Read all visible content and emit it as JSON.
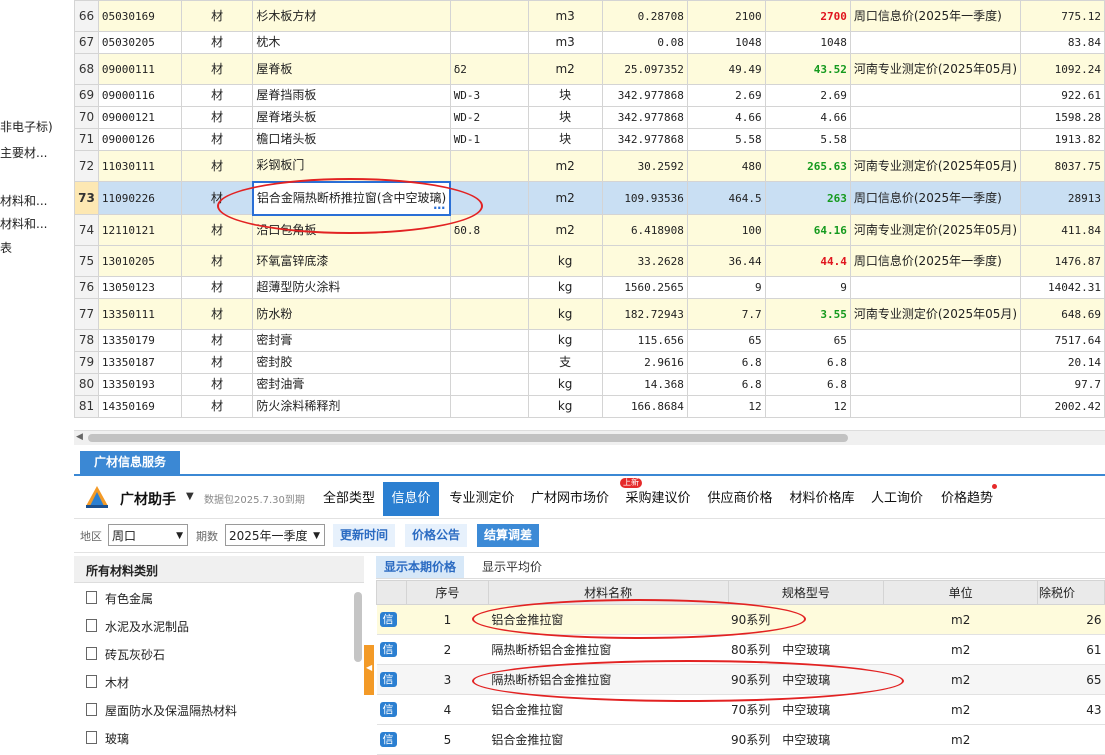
{
  "left_tree": [
    "非电子标)",
    "主要材...",
    "材料和...",
    "材料和...",
    "表"
  ],
  "materials": [
    {
      "n": "66",
      "code": "05030169",
      "type": "材",
      "name": "杉木板方材",
      "spec": "",
      "unit": "m3",
      "qty": "0.28708",
      "price": "2100",
      "market": "2700",
      "mcolor": "red",
      "source": "周口信息价(2025年一季度)",
      "total": "775.12",
      "style": "yellow"
    },
    {
      "n": "67",
      "code": "05030205",
      "type": "材",
      "name": "枕木",
      "spec": "",
      "unit": "m3",
      "qty": "0.08",
      "price": "1048",
      "market": "1048",
      "mcolor": "",
      "source": "",
      "total": "83.84",
      "style": "white"
    },
    {
      "n": "68",
      "code": "09000111",
      "type": "材",
      "name": "屋脊板",
      "spec": "δ2",
      "unit": "m2",
      "qty": "25.097352",
      "price": "49.49",
      "market": "43.52",
      "mcolor": "green",
      "source": "河南专业测定价(2025年05月)",
      "total": "1092.24",
      "style": "yellow"
    },
    {
      "n": "69",
      "code": "09000116",
      "type": "材",
      "name": "屋脊挡雨板",
      "spec": "WD-3",
      "unit": "块",
      "qty": "342.977868",
      "price": "2.69",
      "market": "2.69",
      "mcolor": "",
      "source": "",
      "total": "922.61",
      "style": "white"
    },
    {
      "n": "70",
      "code": "09000121",
      "type": "材",
      "name": "屋脊堵头板",
      "spec": "WD-2",
      "unit": "块",
      "qty": "342.977868",
      "price": "4.66",
      "market": "4.66",
      "mcolor": "",
      "source": "",
      "total": "1598.28",
      "style": "white"
    },
    {
      "n": "71",
      "code": "09000126",
      "type": "材",
      "name": "檐口堵头板",
      "spec": "WD-1",
      "unit": "块",
      "qty": "342.977868",
      "price": "5.58",
      "market": "5.58",
      "mcolor": "",
      "source": "",
      "total": "1913.82",
      "style": "white"
    },
    {
      "n": "72",
      "code": "11030111",
      "type": "材",
      "name": "彩钢板门",
      "spec": "",
      "unit": "m2",
      "qty": "30.2592",
      "price": "480",
      "market": "265.63",
      "mcolor": "green",
      "source": "河南专业测定价(2025年05月)",
      "total": "8037.75",
      "style": "yellow"
    },
    {
      "n": "73",
      "code": "11090226",
      "type": "材",
      "name": "铝合金隔热断桥推拉窗(含中空玻璃)",
      "spec": "",
      "unit": "m2",
      "qty": "109.93536",
      "price": "464.5",
      "market": "263",
      "mcolor": "green",
      "source": "周口信息价(2025年一季度)",
      "total": "28913",
      "style": "selected"
    },
    {
      "n": "74",
      "code": "12110121",
      "type": "材",
      "name": "沿口包角板",
      "spec": "δ0.8",
      "unit": "m2",
      "qty": "6.418908",
      "price": "100",
      "market": "64.16",
      "mcolor": "green",
      "source": "河南专业测定价(2025年05月)",
      "total": "411.84",
      "style": "yellow"
    },
    {
      "n": "75",
      "code": "13010205",
      "type": "材",
      "name": "环氧富锌底漆",
      "spec": "",
      "unit": "kg",
      "qty": "33.2628",
      "price": "36.44",
      "market": "44.4",
      "mcolor": "red",
      "source": "周口信息价(2025年一季度)",
      "total": "1476.87",
      "style": "yellow"
    },
    {
      "n": "76",
      "code": "13050123",
      "type": "材",
      "name": "超薄型防火涂料",
      "spec": "",
      "unit": "kg",
      "qty": "1560.2565",
      "price": "9",
      "market": "9",
      "mcolor": "",
      "source": "",
      "total": "14042.31",
      "style": "white"
    },
    {
      "n": "77",
      "code": "13350111",
      "type": "材",
      "name": "防水粉",
      "spec": "",
      "unit": "kg",
      "qty": "182.72943",
      "price": "7.7",
      "market": "3.55",
      "mcolor": "green",
      "source": "河南专业测定价(2025年05月)",
      "total": "648.69",
      "style": "yellow"
    },
    {
      "n": "78",
      "code": "13350179",
      "type": "材",
      "name": "密封膏",
      "spec": "",
      "unit": "kg",
      "qty": "115.656",
      "price": "65",
      "market": "65",
      "mcolor": "",
      "source": "",
      "total": "7517.64",
      "style": "white"
    },
    {
      "n": "79",
      "code": "13350187",
      "type": "材",
      "name": "密封胶",
      "spec": "",
      "unit": "支",
      "qty": "2.9616",
      "price": "6.8",
      "market": "6.8",
      "mcolor": "",
      "source": "",
      "total": "20.14",
      "style": "white"
    },
    {
      "n": "80",
      "code": "13350193",
      "type": "材",
      "name": "密封油膏",
      "spec": "",
      "unit": "kg",
      "qty": "14.368",
      "price": "6.8",
      "market": "6.8",
      "mcolor": "",
      "source": "",
      "total": "97.7",
      "style": "white"
    },
    {
      "n": "81",
      "code": "14350169",
      "type": "材",
      "name": "防火涂料稀释剂",
      "spec": "",
      "unit": "kg",
      "qty": "166.8684",
      "price": "12",
      "market": "12",
      "mcolor": "",
      "source": "",
      "total": "2002.42",
      "style": "white"
    }
  ],
  "panel": {
    "tab": "广材信息服务",
    "brand": "广材助手",
    "pkg": "数据包2025.7.30到期",
    "nav": [
      "全部类型",
      "信息价",
      "专业测定价",
      "广材网市场价",
      "采购建议价",
      "供应商价格",
      "材料价格库",
      "人工询价",
      "价格趋势"
    ],
    "new_badge": "上新",
    "filter": {
      "region_label": "地区",
      "region": "周口",
      "period_label": "期数",
      "period": "2025年一季度",
      "btn_update": "更新时间",
      "btn_notice": "价格公告",
      "btn_settle": "结算调差"
    },
    "categories_title": "所有材料类别",
    "categories": [
      "有色金属",
      "水泥及水泥制品",
      "砖瓦灰砂石",
      "木材",
      "屋面防水及保温隔热材料",
      "玻璃"
    ],
    "right_tabs": [
      "显示本期价格",
      "显示平均价"
    ],
    "columns": [
      "序号",
      "材料名称",
      "规格型号",
      "单位",
      "除税价"
    ],
    "xin": "信",
    "price_rows": [
      {
        "n": "1",
        "name": "铝合金推拉窗",
        "spec": "90系列",
        "unit": "m2",
        "price": "26",
        "style": "hl"
      },
      {
        "n": "2",
        "name": "隔热断桥铝合金推拉窗",
        "spec": "80系列　中空玻璃",
        "unit": "m2",
        "price": "61",
        "style": "white"
      },
      {
        "n": "3",
        "name": "隔热断桥铝合金推拉窗",
        "spec": "90系列　中空玻璃",
        "unit": "m2",
        "price": "65",
        "style": "gray"
      },
      {
        "n": "4",
        "name": "铝合金推拉窗",
        "spec": "70系列　中空玻璃",
        "unit": "m2",
        "price": "43",
        "style": "white"
      },
      {
        "n": "5",
        "name": "铝合金推拉窗",
        "spec": "90系列　中空玻璃",
        "unit": "m2",
        "price": "",
        "style": "white"
      }
    ]
  }
}
